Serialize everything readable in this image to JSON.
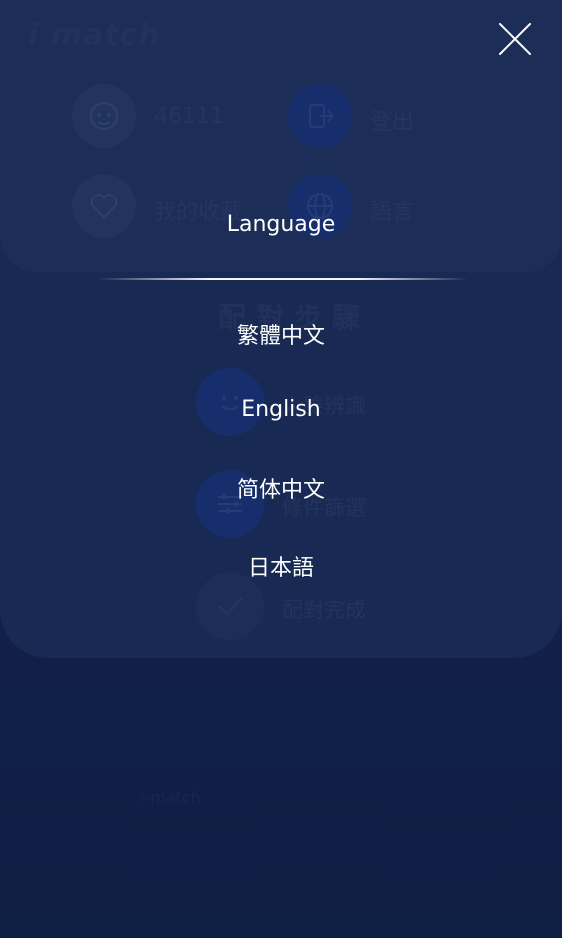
{
  "app": {
    "logo": "i match"
  },
  "profile": {
    "user_id": "46111",
    "logout_label": "登出",
    "favorites_label": "我的收藏",
    "language_label": "語言"
  },
  "steps": {
    "title": "配對步驟",
    "items": [
      {
        "label": "人臉辨識"
      },
      {
        "label": "條件篩選"
      },
      {
        "label": "配對完成"
      }
    ]
  },
  "footer": {
    "faint_text": "i-match"
  },
  "language_menu": {
    "title": "Language",
    "options": [
      {
        "label": "繁體中文"
      },
      {
        "label": "English"
      },
      {
        "label": "简体中文"
      },
      {
        "label": "日本語"
      }
    ]
  },
  "colors": {
    "background": "#14234a",
    "accent_blue": "#1a3a86",
    "text_white": "#ffffff"
  }
}
